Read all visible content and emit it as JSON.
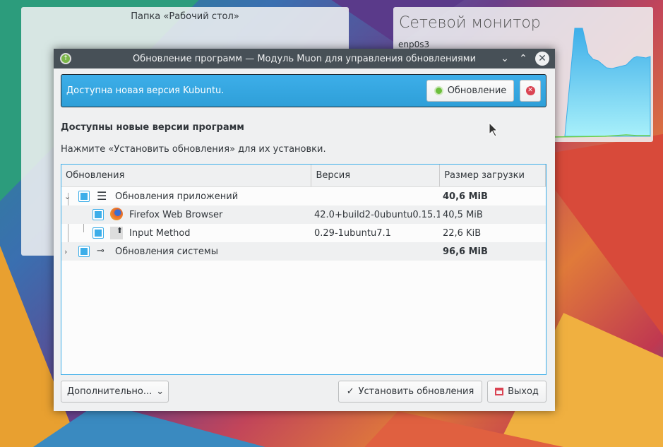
{
  "desktop": {
    "folder_widget_title": "Папка «Рабочий стол»",
    "net_widget_title": "Сетевой монитор",
    "net_interface": "enp0s3"
  },
  "window": {
    "title": "Обновление программ — Модуль Muon для управления обновлениями"
  },
  "banner": {
    "message": "Доступна новая версия Kubuntu.",
    "upgrade_label": "Обновление",
    "color": "#3daee9"
  },
  "heading": "Доступны новые версии программ",
  "hint": "Нажмите «Установить обновления» для их установки.",
  "table": {
    "columns": [
      "Обновления",
      "Версия",
      "Размер загрузки"
    ],
    "rows": [
      {
        "name": "Обновления приложений",
        "version": "",
        "size": "40,6 MiB",
        "level": 0,
        "expanded": true,
        "icon": "menu-icon",
        "checked": true
      },
      {
        "name": "Firefox Web Browser",
        "version": "42.0+build2-0ubuntu0.15.1...",
        "size": "40,5 MiB",
        "level": 1,
        "icon": "firefox-icon",
        "checked": true
      },
      {
        "name": "Input Method",
        "version": "0.29-1ubuntu7.1",
        "size": "22,6 KiB",
        "level": 1,
        "icon": "input-method-icon",
        "checked": true
      },
      {
        "name": "Обновления системы",
        "version": "",
        "size": "96,6 MiB",
        "level": 0,
        "expanded": false,
        "icon": "settings-icon",
        "checked": true
      }
    ]
  },
  "footer": {
    "more_label": "Дополнительно...",
    "install_label": "Установить обновления",
    "quit_label": "Выход"
  }
}
